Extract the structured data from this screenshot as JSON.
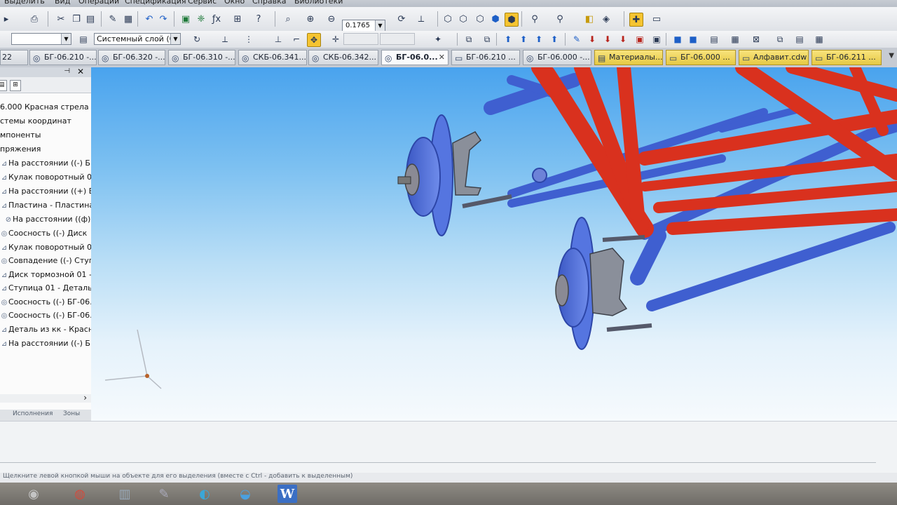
{
  "menu": {
    "items": [
      "Выделить",
      "Вид",
      "Операции",
      "Спецификация",
      "Сервис",
      "Окно",
      "Справка",
      "Библиотеки"
    ]
  },
  "toolbar": {
    "zoom_value": "0.1765",
    "layer_combo": "Системный слой (0)",
    "style_combo": ""
  },
  "tabs": [
    {
      "label": "22",
      "icon": "part-icon"
    },
    {
      "label": "БГ-06.210 -...",
      "icon": "assembly-icon"
    },
    {
      "label": "БГ-06.320 -...",
      "icon": "assembly-icon"
    },
    {
      "label": "БГ-06.310 -...",
      "icon": "assembly-icon"
    },
    {
      "label": "СКБ-06.341...",
      "icon": "assembly-icon"
    },
    {
      "label": "СКБ-06.342...",
      "icon": "assembly-icon"
    },
    {
      "label": "БГ-06.0...",
      "icon": "assembly-icon",
      "active": true
    },
    {
      "label": "БГ-06.210 ...",
      "icon": "drawing-icon"
    },
    {
      "label": "БГ-06.000 -...",
      "icon": "assembly-icon"
    },
    {
      "label": "Материалы...",
      "icon": "document-icon",
      "highlight": true
    },
    {
      "label": "БГ-06.000 ...",
      "icon": "drawing-icon",
      "highlight": true
    },
    {
      "label": "Алфавит.cdw",
      "icon": "drawing-icon",
      "highlight": true
    },
    {
      "label": "БГ-06.211 ...",
      "icon": "drawing-icon",
      "highlight": true
    }
  ],
  "tree": {
    "rows": [
      {
        "label": "6.000 Красная стрела (",
        "icon": "root-icon"
      },
      {
        "label": "стемы координат",
        "icon": "folder-icon"
      },
      {
        "label": "мпоненты",
        "icon": "folder-icon"
      },
      {
        "label": "пряжения",
        "icon": "folder-icon"
      },
      {
        "label": "На расстоянии ((-) БГ",
        "icon": "mate-icon"
      },
      {
        "label": "Кулак поворотный 0",
        "icon": "mate-icon"
      },
      {
        "label": "На расстоянии ((+) Б",
        "icon": "mate-icon"
      },
      {
        "label": "Пластина - Пластина",
        "icon": "mate-icon"
      },
      {
        "label": "На расстоянии ((ф)",
        "icon": "mate-icon"
      },
      {
        "label": "Соосность ((-) Диск",
        "icon": "mate-icon"
      },
      {
        "label": "Кулак поворотный 0",
        "icon": "mate-icon"
      },
      {
        "label": "Совпадение ((-) Ступ",
        "icon": "mate-icon"
      },
      {
        "label": "Диск тормозной 01 -",
        "icon": "mate-icon"
      },
      {
        "label": "Ступица 01 - Деталь",
        "icon": "mate-icon"
      },
      {
        "label": "Соосность ((-) БГ-06.",
        "icon": "mate-icon"
      },
      {
        "label": "Соосность ((-) БГ-06.",
        "icon": "mate-icon"
      },
      {
        "label": "Деталь из кк - Красн",
        "icon": "mate-icon"
      },
      {
        "label": "На расстоянии ((-) Б",
        "icon": "mate-icon"
      }
    ],
    "bottom_tabs": [
      "Исполнения",
      "Зоны"
    ]
  },
  "status": {
    "text": "Щелкните левой кнопкой мыши на объекте для его выделения (вместе с Ctrl - добавить к выделенным)"
  },
  "taskbar": {
    "word_label": "W"
  },
  "colors": {
    "frame_red": "#d9311e",
    "arm_blue": "#4a6ad8",
    "hub_blue": "#5575e0",
    "highlight_yellow": "#f5c431"
  }
}
